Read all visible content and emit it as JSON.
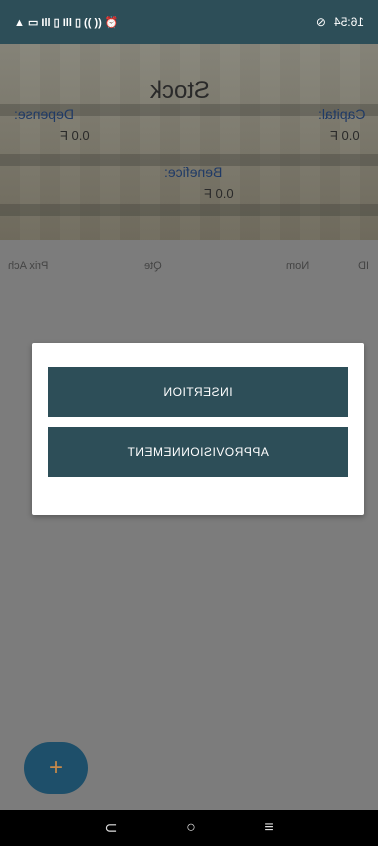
{
  "status_bar": {
    "left_text": "▲ ▭ Ill ▯ Ill ▯ (( )) ⏰",
    "time": "16:54",
    "icon_right": "clock-icon"
  },
  "hero": {
    "title": "Stock",
    "depense_label": "Depense:",
    "depense_value": "0.0 F",
    "capital_label": "Capital:",
    "capital_value": "0.0 F",
    "benefice_label": "Benefice:",
    "benefice_value": "0.0 F"
  },
  "table": {
    "headers": [
      "ID",
      "Nom",
      "Qte",
      "Prix Ach"
    ]
  },
  "dialog": {
    "insertion_label": "INSERTION",
    "approvisionnement_label": "APPROVISIONNEMENT"
  },
  "fab": {
    "label": "+"
  },
  "nav": {
    "back_icon": "back-icon",
    "home_icon": "home-icon",
    "menu_icon": "menu-icon"
  }
}
